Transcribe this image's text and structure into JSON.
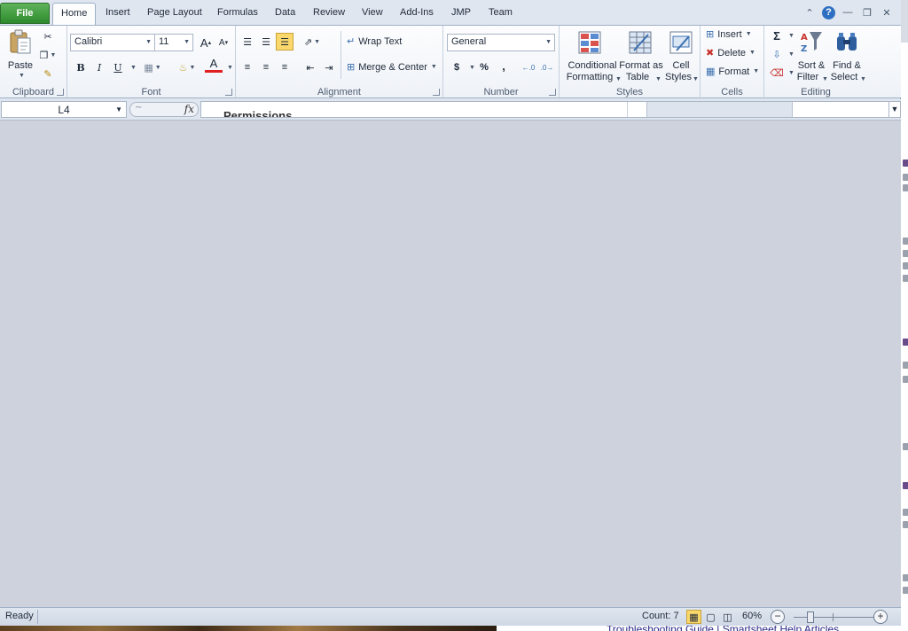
{
  "tabs": {
    "file": "File",
    "items": [
      "Home",
      "Insert",
      "Page Layout",
      "Formulas",
      "Data",
      "Review",
      "View",
      "Add-Ins",
      "JMP",
      "Team"
    ],
    "active": "Home"
  },
  "ribbon": {
    "clipboard": {
      "label": "Clipboard",
      "paste": "Paste"
    },
    "font": {
      "label": "Font",
      "name": "Calibri",
      "size": "11",
      "bold": "B",
      "italic": "I",
      "underline": "U"
    },
    "alignment": {
      "label": "Alignment",
      "wrap_text": "Wrap Text",
      "merge_center": "Merge & Center"
    },
    "number": {
      "label": "Number",
      "format": "General",
      "currency": "$",
      "percent": "%",
      "comma": ","
    },
    "styles": {
      "label": "Styles",
      "conditional_1": "Conditional",
      "conditional_2": "Formatting",
      "format_table_1": "Format as",
      "format_table_2": "Table",
      "cell_styles_1": "Cell",
      "cell_styles_2": "Styles"
    },
    "cells": {
      "label": "Cells",
      "insert": "Insert",
      "delete": "Delete",
      "format": "Format"
    },
    "editing": {
      "label": "Editing",
      "sort_1": "Sort &",
      "sort_2": "Filter",
      "find_1": "Find &",
      "find_2": "Select",
      "sigma": "Σ"
    }
  },
  "formula_bar": {
    "name_box": "L4",
    "fx": "fx",
    "content": "Permissions"
  },
  "status": {
    "ready": "Ready",
    "count": "Count: 7",
    "zoom": "60%",
    "zoom_percent": 60
  },
  "background": {
    "link": "Troubleshooting Guide | Smartsheet Help Articles"
  },
  "colors": {
    "file_tab": "#2d8a2d",
    "sheet_bg": "#cdd2dc",
    "ribbon_border": "#9fb0c6"
  }
}
